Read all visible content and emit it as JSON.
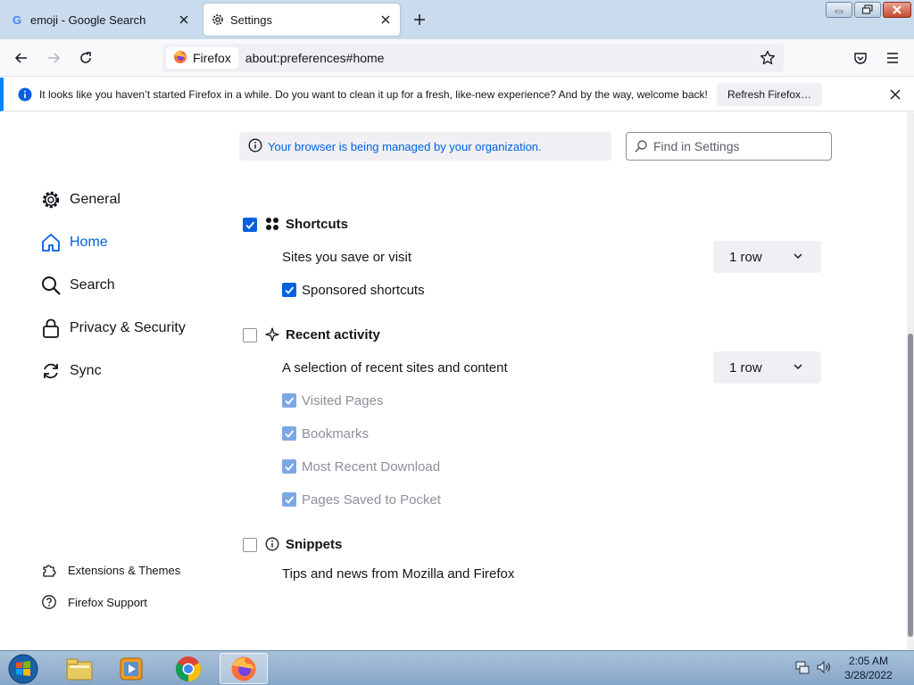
{
  "browser": {
    "tabs": [
      {
        "title": "emoji - Google Search",
        "favicon": "google-icon",
        "active": false
      },
      {
        "title": "Settings",
        "favicon": "gear-icon",
        "active": true
      }
    ],
    "identity_label": "Firefox",
    "url": "about:preferences#home"
  },
  "notification": {
    "text": "It looks like you haven’t started Firefox in a while. Do you want to clean it up for a fresh, like-new experience? And by the way, welcome back!",
    "button_label": "Refresh Firefox…"
  },
  "settings": {
    "managed_notice": "Your browser is being managed by your organization.",
    "search_placeholder": "Find in Settings",
    "categories": [
      {
        "label": "General",
        "icon": "gear-icon",
        "selected": false
      },
      {
        "label": "Home",
        "icon": "home-icon",
        "selected": true
      },
      {
        "label": "Search",
        "icon": "search-icon",
        "selected": false
      },
      {
        "label": "Privacy & Security",
        "icon": "lock-icon",
        "selected": false
      },
      {
        "label": "Sync",
        "icon": "sync-icon",
        "selected": false
      }
    ],
    "footer_links": [
      {
        "label": "Extensions & Themes",
        "icon": "puzzle-icon"
      },
      {
        "label": "Firefox Support",
        "icon": "help-icon"
      }
    ],
    "shortcuts": {
      "title": "Shortcuts",
      "checked": true,
      "description": "Sites you save or visit",
      "rows_value": "1 row",
      "sponsored_label": "Sponsored shortcuts",
      "sponsored_checked": true
    },
    "recent_activity": {
      "title": "Recent activity",
      "checked": false,
      "description": "A selection of recent sites and content",
      "rows_value": "1 row",
      "options": [
        {
          "label": "Visited Pages",
          "checked": true,
          "disabled": true
        },
        {
          "label": "Bookmarks",
          "checked": true,
          "disabled": true
        },
        {
          "label": "Most Recent Download",
          "checked": true,
          "disabled": true
        },
        {
          "label": "Pages Saved to Pocket",
          "checked": true,
          "disabled": true
        }
      ]
    },
    "snippets": {
      "title": "Snippets",
      "checked": false,
      "description": "Tips and news from Mozilla and Firefox"
    }
  },
  "taskbar": {
    "apps": [
      "file-explorer-icon",
      "media-player-icon",
      "chrome-icon",
      "firefox-icon"
    ],
    "active_app": "firefox-icon",
    "time": "2:05 AM",
    "date": "3/28/2022"
  },
  "colors": {
    "accent": "#0061e0",
    "tab_strip": "#c9dced",
    "notification_accent": "#0a84ff"
  }
}
